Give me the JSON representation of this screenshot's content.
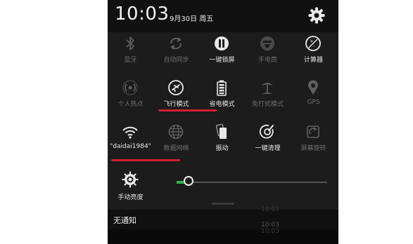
{
  "status": {
    "time": "10:03",
    "date": "9月30日 周五"
  },
  "toggles": [
    [
      {
        "label": "蓝牙",
        "active": false,
        "icon": "bluetooth-icon"
      },
      {
        "label": "自动同步",
        "active": false,
        "icon": "auto-sync-icon"
      },
      {
        "label": "一键锁屏",
        "active": true,
        "icon": "lock-screen-icon"
      },
      {
        "label": "手电筒",
        "active": false,
        "icon": "flashlight-icon"
      },
      {
        "label": "计算器",
        "active": true,
        "icon": "calculator-icon"
      }
    ],
    [
      {
        "label": "个人热点",
        "active": false,
        "icon": "hotspot-icon"
      },
      {
        "label": "飞行模式",
        "active": true,
        "icon": "airplane-icon"
      },
      {
        "label": "省电模式",
        "active": true,
        "icon": "battery-icon"
      },
      {
        "label": "免打扰模式",
        "active": false,
        "icon": "do-not-disturb-icon"
      },
      {
        "label": "GPS",
        "active": false,
        "icon": "gps-icon"
      }
    ],
    [
      {
        "label": "\"daidai1984\"",
        "active": true,
        "icon": "wifi-icon"
      },
      {
        "label": "数据网络",
        "active": false,
        "icon": "data-network-icon"
      },
      {
        "label": "振动",
        "active": true,
        "icon": "vibrate-icon"
      },
      {
        "label": "一键清理",
        "active": true,
        "icon": "clean-icon"
      },
      {
        "label": "屏幕旋转",
        "active": false,
        "icon": "rotate-icon"
      }
    ]
  ],
  "brightness": {
    "label": "手动亮度",
    "level": 0.08
  },
  "notifications": {
    "empty_label": "无通知"
  },
  "background_text": [
    "10:03",
    "10:03",
    "10:03"
  ],
  "colors": {
    "panel": "#1c1c1c",
    "highlight": "#d3202f",
    "slider": "#2fb24a"
  }
}
